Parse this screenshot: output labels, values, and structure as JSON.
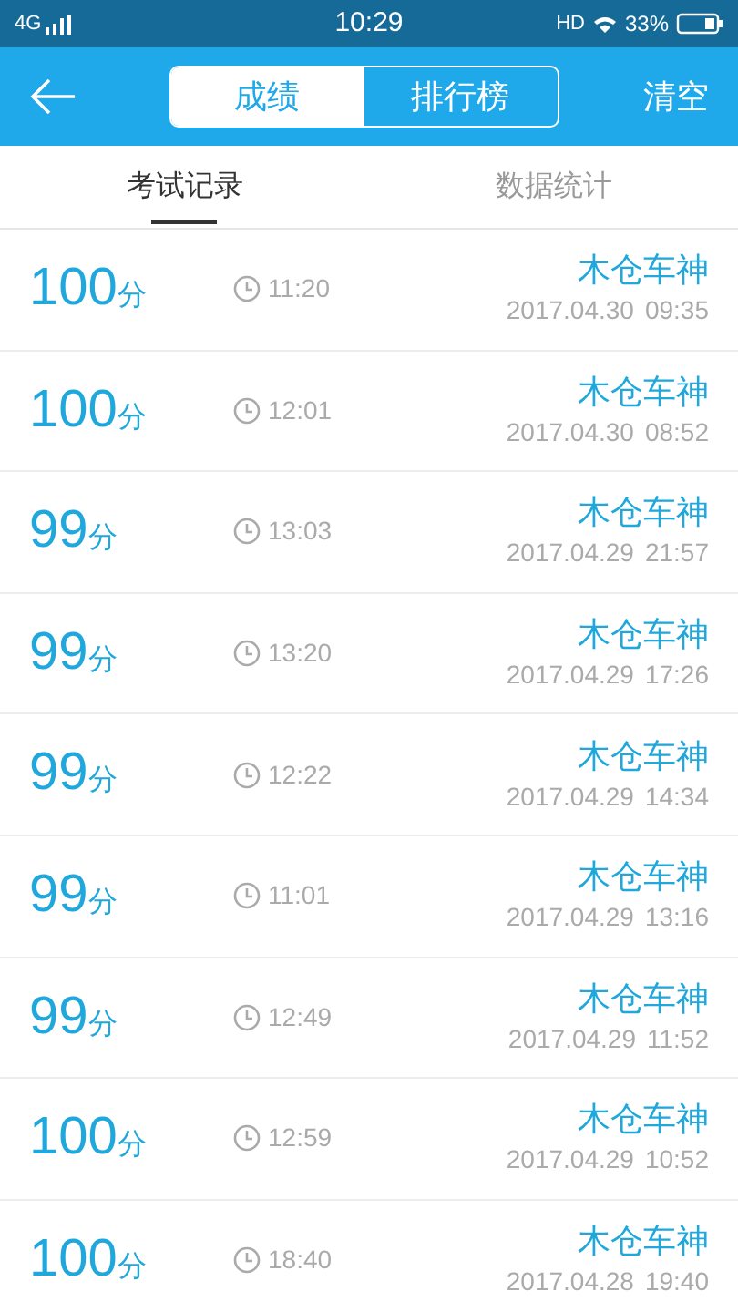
{
  "status_bar": {
    "network": "4G",
    "time": "10:29",
    "hd": "HD",
    "battery": "33%"
  },
  "header": {
    "segments": [
      {
        "label": "成绩",
        "selected": true
      },
      {
        "label": "排行榜",
        "selected": false
      }
    ],
    "action": "清空"
  },
  "tabs": [
    {
      "label": "考试记录",
      "selected": true
    },
    {
      "label": "数据统计",
      "selected": false
    }
  ],
  "records": [
    {
      "score": "100",
      "unit": "分",
      "duration": "11:20",
      "name": "木仓车神",
      "date": "2017.04.30",
      "time": "09:35"
    },
    {
      "score": "100",
      "unit": "分",
      "duration": "12:01",
      "name": "木仓车神",
      "date": "2017.04.30",
      "time": "08:52"
    },
    {
      "score": "99",
      "unit": "分",
      "duration": "13:03",
      "name": "木仓车神",
      "date": "2017.04.29",
      "time": "21:57"
    },
    {
      "score": "99",
      "unit": "分",
      "duration": "13:20",
      "name": "木仓车神",
      "date": "2017.04.29",
      "time": "17:26"
    },
    {
      "score": "99",
      "unit": "分",
      "duration": "12:22",
      "name": "木仓车神",
      "date": "2017.04.29",
      "time": "14:34"
    },
    {
      "score": "99",
      "unit": "分",
      "duration": "11:01",
      "name": "木仓车神",
      "date": "2017.04.29",
      "time": "13:16"
    },
    {
      "score": "99",
      "unit": "分",
      "duration": "12:49",
      "name": "木仓车神",
      "date": "2017.04.29",
      "time": "11:52"
    },
    {
      "score": "100",
      "unit": "分",
      "duration": "12:59",
      "name": "木仓车神",
      "date": "2017.04.29",
      "time": "10:52"
    },
    {
      "score": "100",
      "unit": "分",
      "duration": "18:40",
      "name": "木仓车神",
      "date": "2017.04.28",
      "time": "19:40"
    }
  ]
}
